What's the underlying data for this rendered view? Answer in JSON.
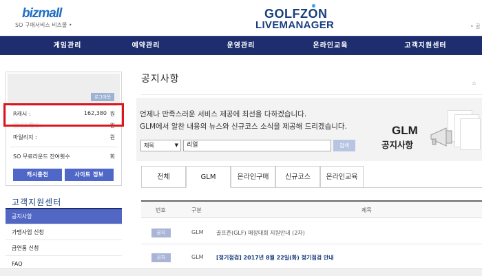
{
  "header": {
    "bizmall_logo": "bizmall",
    "bizmall_sub": "SO 구매서비스 비즈몰 •",
    "logo_line1": "GOLFZON",
    "logo_line2": "LIVEMANAGER",
    "top_right": "• 골"
  },
  "nav": {
    "items": [
      {
        "label": "게임관리"
      },
      {
        "label": "예약관리"
      },
      {
        "label": "운영관리"
      },
      {
        "label": "온라인교육"
      },
      {
        "label": "고객지원센터"
      }
    ]
  },
  "account": {
    "logout_label": "로그아웃",
    "rcash_label": "R캐시 :",
    "rcash_value": "162,380",
    "rcash_unit": "원",
    "blurred_label": "보너스캐시 :",
    "blurred_unit": "원",
    "mileage_label": "마일리지 :",
    "mileage_unit": "원",
    "free_round_label": "SO 무료라운드 잔여횟수",
    "free_round_unit": "회",
    "cash_charge_label": "캐시충전",
    "site_info_label": "사이트 정보"
  },
  "customer_center": {
    "title": "고객지원센터",
    "items": [
      {
        "label": "공지사항"
      },
      {
        "label": "가맹사업 신청"
      },
      {
        "label": "금연룸 신청"
      },
      {
        "label": "FAQ"
      }
    ]
  },
  "main": {
    "page_title": "공지사항",
    "banner_line1": "언제나 만족스러운 서비스 제공에 최선을 다하겠습니다.",
    "banner_line2": "GLM에서 알찬 내용의 뉴스와 신규코스 소식을 제공해 드리겠습니다.",
    "banner_big": "GLM",
    "banner_sub": "공지사항",
    "search_select": "제목",
    "search_value": "리얼",
    "search_button": "검색",
    "tabs": [
      {
        "label": "전체"
      },
      {
        "label": "GLM"
      },
      {
        "label": "온라인구매"
      },
      {
        "label": "신규코스"
      },
      {
        "label": "온라인교육"
      }
    ],
    "table_headers": {
      "num": "번호",
      "category": "구분",
      "title": "제목"
    },
    "rows": [
      {
        "badge": "공지",
        "category": "GLM",
        "title": "골프존(GLF) 매장대회 지원안내 (2차)"
      },
      {
        "badge": "공지",
        "category": "GLM",
        "title": "[정기점검] 2017년 8월 22일(화) 정기점검 안내"
      }
    ]
  },
  "colors": {
    "nav_bg": "#1d2d6e",
    "accent_blue": "#4f67c6",
    "highlight_red": "#e0141c"
  }
}
